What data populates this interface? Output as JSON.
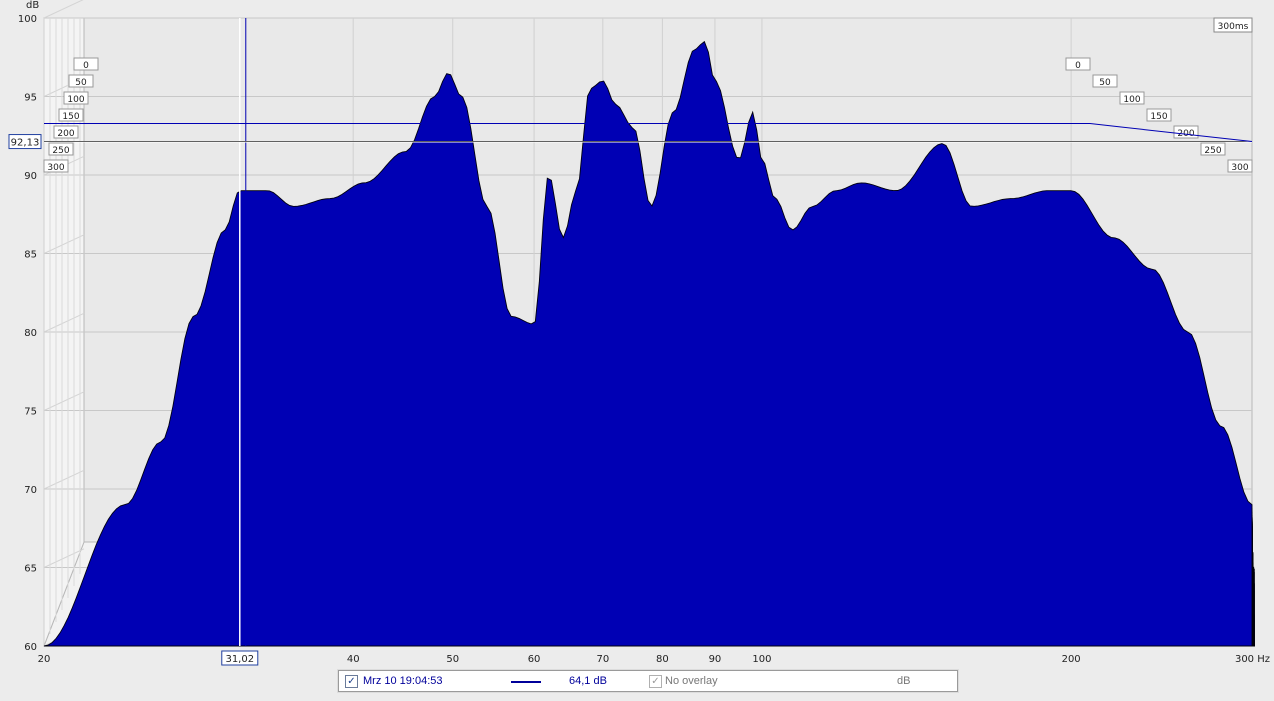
{
  "chart_data": {
    "type": "area",
    "title": "",
    "y_unit": "dB",
    "ylim": [
      60,
      100
    ],
    "y_ticks": [
      60,
      65,
      70,
      75,
      80,
      85,
      90,
      95,
      100
    ],
    "xlim": [
      20,
      300
    ],
    "x_scale": "log",
    "x_ticks": [
      20,
      40,
      50,
      60,
      70,
      80,
      90,
      100,
      200
    ],
    "x_unit_label": "300 Hz",
    "time_ms_labels": [
      "0",
      "50",
      "100",
      "150",
      "200",
      "250",
      "300"
    ],
    "time_max_label": "300ms",
    "cursor": {
      "x_label": "31,02",
      "y_label": "92,13",
      "x": 31.02,
      "y": 92.13
    },
    "fill_color": "#0000b4",
    "outline_color": "#000010",
    "surface": {
      "freq_hz": [
        20,
        24,
        26,
        28,
        30,
        31,
        33,
        35,
        38,
        41,
        45,
        48,
        49.5,
        51,
        54,
        57,
        60,
        62,
        64,
        66,
        68,
        70,
        72,
        75,
        78,
        82,
        86,
        88,
        90,
        95,
        98,
        100,
        103,
        107,
        112,
        118,
        125,
        135,
        150,
        160,
        175,
        190,
        200,
        220,
        240,
        260,
        280,
        300
      ],
      "first_slice_db": [
        60,
        69,
        73,
        81,
        86.5,
        89,
        89,
        88,
        88.5,
        89.5,
        91.5,
        95,
        96.5,
        95,
        88,
        81,
        80.5,
        90,
        86,
        89,
        95.5,
        96,
        94.5,
        93,
        88,
        94,
        98,
        98.5,
        96,
        91,
        94,
        91,
        88.5,
        86.5,
        88,
        89,
        89.5,
        89,
        92,
        88,
        88.5,
        89,
        89,
        86,
        84,
        80,
        74,
        69
      ],
      "slice_count": 60,
      "time_span_ms": 300
    }
  },
  "legend": {
    "checkbox_mark": "✓",
    "series_label": "Mrz 10 19:04:53",
    "series_value": "64,1 dB",
    "overlay_label": "No overlay",
    "overlay_unit": "dB",
    "series_color": "#00009a"
  }
}
